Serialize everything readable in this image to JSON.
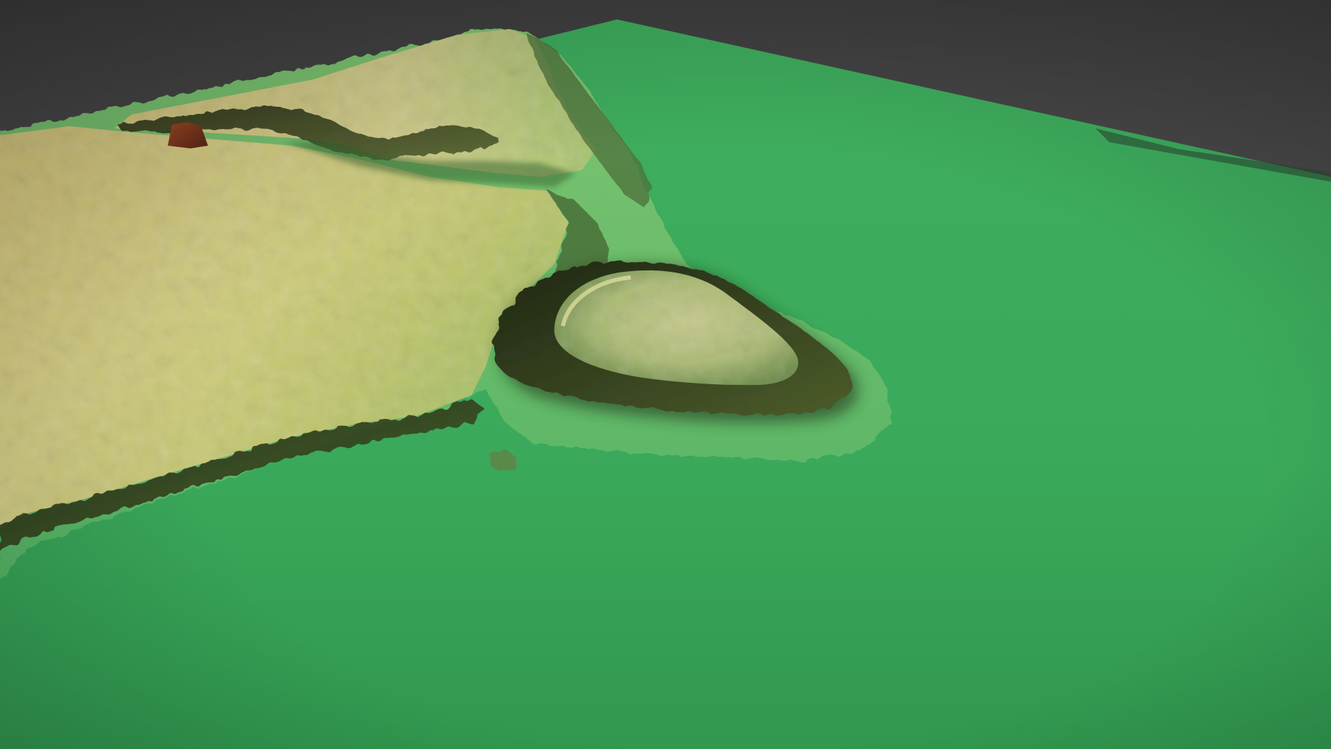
{
  "scene": {
    "background_color": "#4f4f4f",
    "sea_color": "#3aa95c",
    "lowland_color": "#5fbf6a",
    "plateau_color_light": "#e2d487",
    "plateau_color_mid": "#c9c26a",
    "peak_color": "#8a3f22",
    "cliff_shadow_color": "#2f3a1a"
  }
}
